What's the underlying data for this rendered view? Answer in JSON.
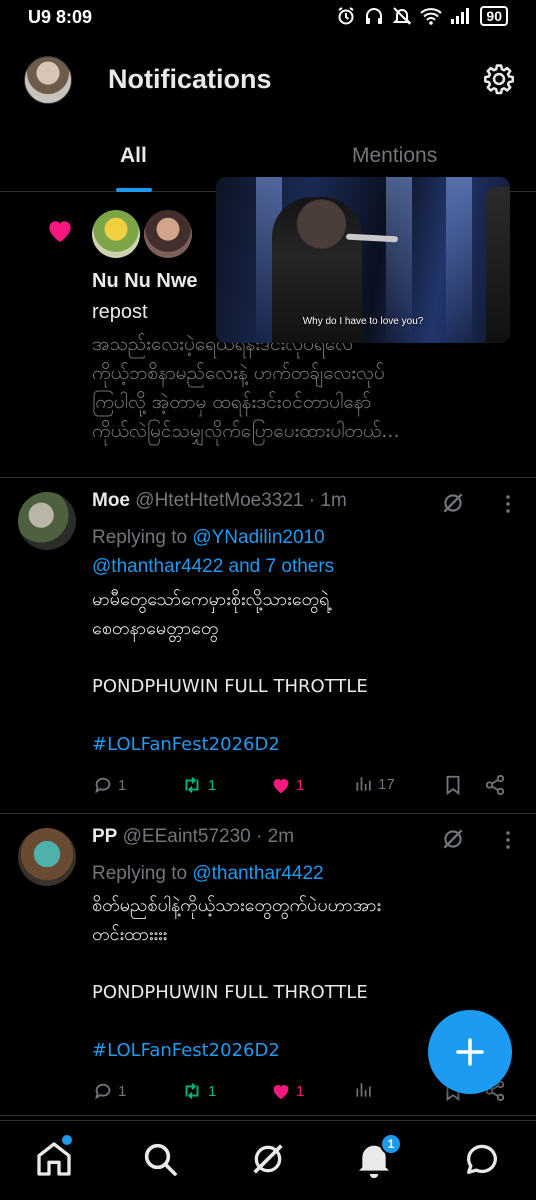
{
  "status_bar": {
    "time": "U9 8:09",
    "battery": "90"
  },
  "header": {
    "title": "Notifications"
  },
  "tabs": [
    {
      "label": "All"
    },
    {
      "label": "Mentions"
    }
  ],
  "like_notification": {
    "name": "Nu Nu Nwe",
    "action": "repost",
    "text": "အသည်းလေးပဲ့ရေယံရန်းဒင်းလိုပ်ရလေဲ\nကိုယ့်ဘစိနာမည်လေးနဲ့ ဟက်တခ်ျလေးလုပ်\nကြပါလို့ အဲ့တာမှ ထရန်းဒင်းဝင်တာပါနော်\nကိုယ်လဲမြင်သမျှလိုက်ပြောပေးထားပါတယ်..."
  },
  "video_overlay": {
    "caption": "Why do I have to love you?"
  },
  "tweets": [
    {
      "name": "Moe",
      "handle": "@HtetHtetMoe3321",
      "time": "· 1m",
      "replying_prefix": "Replying to ",
      "replying_mentions": "@YNadilin2010\n@thanthar4422 and 7 others",
      "body": "မာမီတွေသော်ကေမှားစိုးလို့သားတွေရဲ့\nစေတနာမေတ္တာတွေ\n\nPONDPHUWIN FULL THROTTLE\n\n",
      "hashtag": "#LOLFanFest2026D2",
      "replies": "1",
      "reposts": "1",
      "likes": "1",
      "views": "17"
    },
    {
      "name": "PP",
      "handle": "@EEaint57230",
      "time": "· 2m",
      "replying_prefix": "Replying to ",
      "replying_mentions": "@thanthar4422",
      "body": "စိတ်မညစ်ပါနဲ့ကိုယ့်သားတွေတွက်ပဲပဟာအား\nတင်းထားးးး\n\nPONDPHUWIN FULL THROTTLE\n\n",
      "hashtag": "#LOLFanFest2026D2",
      "replies": "1",
      "reposts": "1",
      "likes": "1",
      "views": ""
    }
  ],
  "bottom_nav": {
    "notification_count": "1"
  },
  "colors": {
    "accent": "#1d9bf0",
    "like": "#f91880",
    "repost": "#00ba7c",
    "muted": "#71767b"
  }
}
